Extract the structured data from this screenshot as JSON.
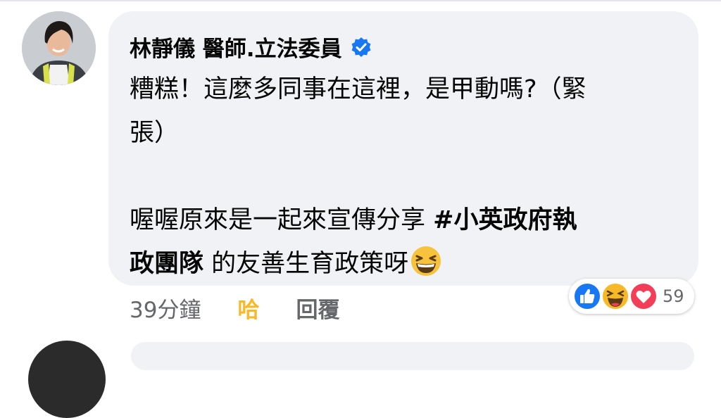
{
  "comment": {
    "author": "林靜儀 醫師.立法委員",
    "verified_icon": "verified-badge-icon",
    "line1": "糟糕！這麼多同事在這裡，是甲動嗎?（緊",
    "line2": "張）",
    "line3_text": "喔喔原來是一起來宣傳分享 ",
    "hashtag_part1": "#小英政府執",
    "hashtag_part2": "政團隊",
    "line4_text": " 的友善生育政策呀",
    "emoji": "grinning-squinting-face-icon"
  },
  "actions": {
    "time": "39分鐘",
    "reaction_label": "哈",
    "reply_label": "回覆"
  },
  "reactions": {
    "icons": [
      "like-icon",
      "haha-icon",
      "love-icon"
    ],
    "count": "59"
  },
  "colors": {
    "bubble": "#f0f2f5",
    "verified": "#1877f2",
    "haha": "#f7b928",
    "love": "#f33e58",
    "meta": "#65676b"
  }
}
